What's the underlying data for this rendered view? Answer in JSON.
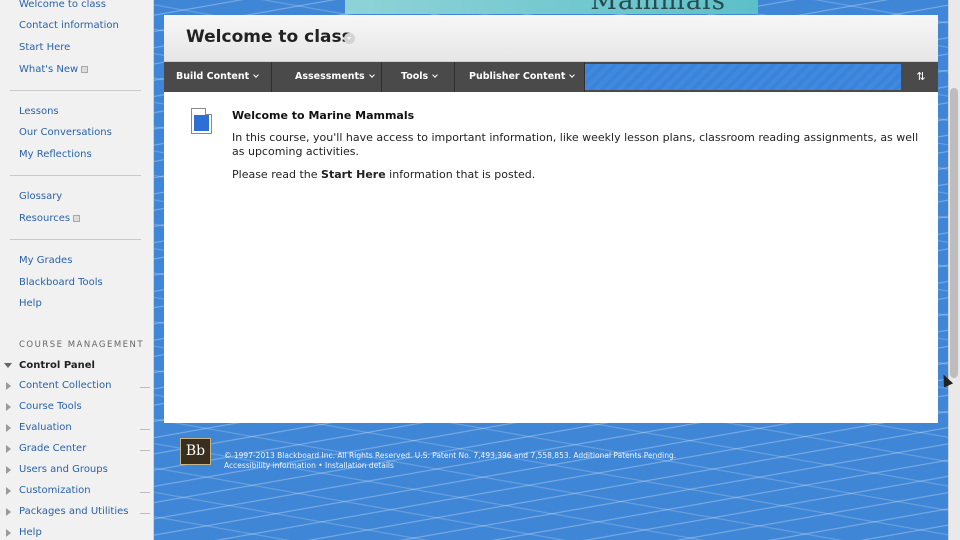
{
  "sidebar": {
    "top_links": [
      {
        "label": "Welcome to class",
        "external": false
      },
      {
        "label": "Contact information",
        "external": false
      },
      {
        "label": "Start Here",
        "external": false
      },
      {
        "label": "What's New",
        "external": true
      },
      {
        "label": "Lessons",
        "external": false
      },
      {
        "label": "Our Conversations",
        "external": false
      },
      {
        "label": "My Reflections",
        "external": false
      },
      {
        "label": "Glossary",
        "external": false
      },
      {
        "label": "Resources",
        "external": true
      },
      {
        "label": "My Grades",
        "external": false
      },
      {
        "label": "Blackboard Tools",
        "external": false
      },
      {
        "label": "Help",
        "external": false
      }
    ],
    "management_title": "COURSE MANAGEMENT",
    "control_panel": {
      "title": "Control Panel",
      "items": [
        {
          "label": "Content Collection",
          "has_dash": true
        },
        {
          "label": "Course Tools",
          "has_dash": false
        },
        {
          "label": "Evaluation",
          "has_dash": true
        },
        {
          "label": "Grade Center",
          "has_dash": true
        },
        {
          "label": "Users and Groups",
          "has_dash": false
        },
        {
          "label": "Customization",
          "has_dash": true
        },
        {
          "label": "Packages and Utilities",
          "has_dash": true
        },
        {
          "label": "Help",
          "has_dash": false
        }
      ]
    }
  },
  "banner": {
    "text": "Mammals"
  },
  "page": {
    "title": "Welcome to class"
  },
  "action_bar": {
    "buttons": [
      "Build Content",
      "Assessments",
      "Tools",
      "Publisher Content"
    ],
    "reorder_icon": "reorder-icon"
  },
  "content_item": {
    "title": "Welcome to Marine Mammals",
    "body": "In this course, you'll have access to important information, like weekly lesson plans, classroom reading assignments, as well as upcoming activities.",
    "body2_prefix": "Please read the ",
    "body2_bold": "Start Here",
    "body2_suffix": " information that is posted."
  },
  "footer": {
    "logo_text": "Bb",
    "copyright": "© 1997-2013 Blackboard Inc. All Rights Reserved. U.S. Patent No. 7,493,396 and 7,558,853. Additional Patents Pending.",
    "links": "Accessibility information   •   Installation details"
  }
}
